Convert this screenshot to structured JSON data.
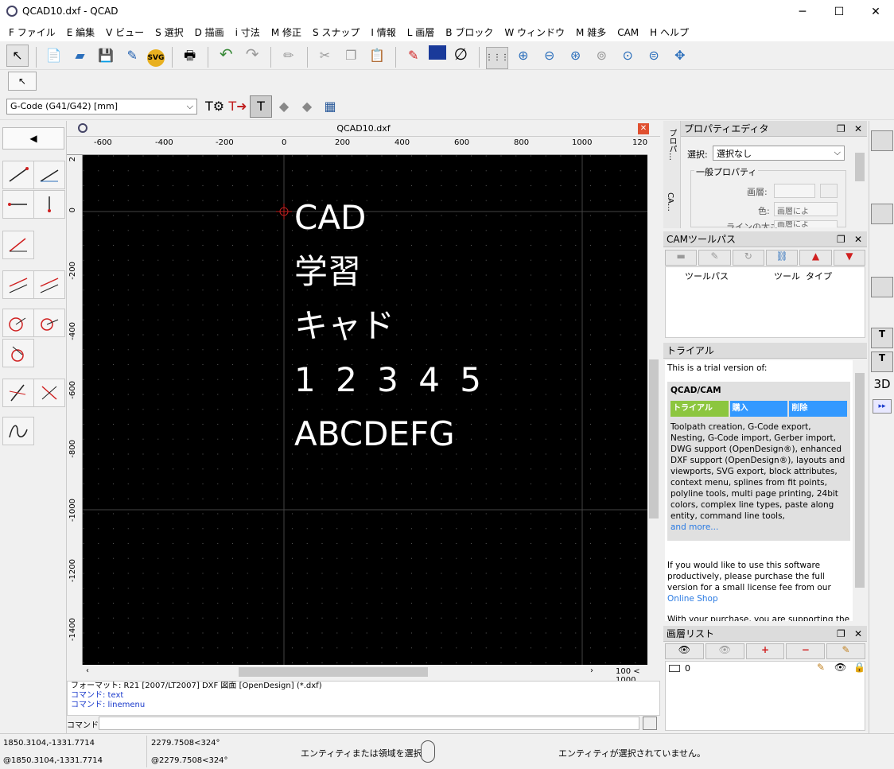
{
  "window": {
    "title": "QCAD10.dxf - QCAD",
    "minimize": "─",
    "maximize": "☐",
    "close": "✕"
  },
  "menu": [
    "F ファイル",
    "E 編集",
    "V ビュー",
    "S 選択",
    "D 描画",
    "i 寸法",
    "M 修正",
    "S スナップ",
    "I 情報",
    "L 画層",
    "B ブロック",
    "W ウィンドウ",
    "M 雑多",
    "CAM",
    "H ヘルプ"
  ],
  "cam_toolbar": {
    "gcode_select": "G-Code (G41/G42) [mm]"
  },
  "document": {
    "tab_title": "QCAD10.dxf"
  },
  "ruler": {
    "h_labels": [
      "-600",
      "-400",
      "-200",
      "0",
      "200",
      "400",
      "600",
      "800",
      "1000",
      "120"
    ],
    "v_labels": [
      "2",
      "0",
      "-200",
      "-400",
      "-600",
      "-800",
      "-1000",
      "-1200",
      "-1400"
    ],
    "scroll_info": "100 < 1000"
  },
  "drawing": {
    "lines": [
      "CAD",
      "学習",
      "キャド",
      "1 2 3 4 5",
      "ABCDEFG"
    ]
  },
  "command": {
    "history": [
      "フォーマット: R21 [2007/LT2007] DXF 図面 [OpenDesign] (*.dxf)",
      "コマンド: text",
      "コマンド: linemenu"
    ],
    "label": "コマンド:"
  },
  "property_editor": {
    "title": "プロパティエディタ",
    "tab1": "プロパ…",
    "tab2": "CA…",
    "select_label": "選択:",
    "select_value": "選択なし",
    "group": "一般プロパティ",
    "layer_label": "画層:",
    "color_label": "色:",
    "color_value": "画層によ",
    "linewidth_label": "ラインの太さ:",
    "linewidth_value": "画層によ"
  },
  "cam_toolpath": {
    "title": "CAMツールパス",
    "col_path": "ツールパス",
    "col_tool": "ツール",
    "col_type": "タイプ"
  },
  "trial": {
    "title": "トライアル",
    "intro": "This is a trial version of:",
    "product": "QCAD/CAM",
    "tab_trial": "トライアル",
    "tab_buy": "購入",
    "tab_remove": "削除",
    "features": "Toolpath creation, G-Code export, Nesting, G-Code import, Gerber import, DWG support (OpenDesign®), enhanced DXF support (OpenDesign®), layouts and viewports, SVG export, block attributes, context menu, splines from fit points, polyline tools, multi page printing, 24bit colors, complex line types, paste along entity, command line tools,",
    "more": "and more...",
    "para1": "If you would like to use this software productively, please purchase the full version for a small license fee from our",
    "shop": "Online Shop",
    "para2": "With your purchase, you are supporting the future development of QCAD/CAM"
  },
  "layer_list": {
    "title": "画層リスト",
    "layer0": "0"
  },
  "status": {
    "abs1": "1850.3104,-1331.7714",
    "abs2": "@1850.3104,-1331.7714",
    "pol1": "2279.7508<324°",
    "pol2": "@2279.7508<324°",
    "hint": "エンティティまたは領域を選択",
    "selection": "エンティティが選択されていません。"
  },
  "right_toolbar": {
    "label3d": "3D"
  },
  "colors": {
    "trial_green": "#8cc63f",
    "trial_blue": "#3399ff",
    "accent_red": "#e02020"
  }
}
